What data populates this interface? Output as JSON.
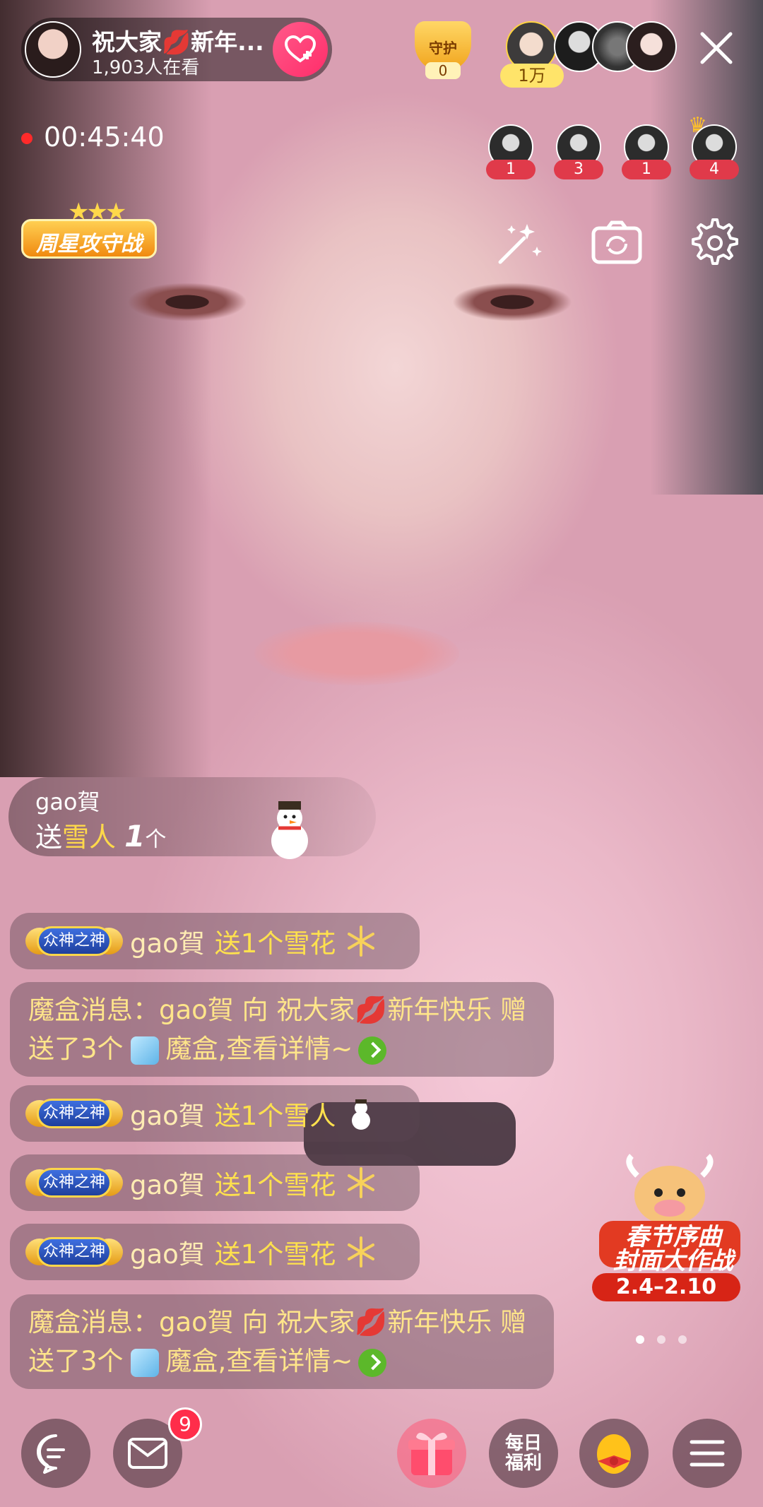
{
  "header": {
    "host_name": "祝大家💋新年...",
    "viewers": "1,903人在看",
    "guard_label": "守护",
    "guard_count": "0",
    "rank_tag": "1万",
    "timer": "00:45:40",
    "weekly_badge": "周星攻守战"
  },
  "fans": [
    {
      "count": "1"
    },
    {
      "count": "3"
    },
    {
      "count": "1"
    },
    {
      "count": "4"
    }
  ],
  "gift_notice": {
    "sender": "gao賀",
    "verb": "送",
    "gift_name": "雪人",
    "count": "1",
    "unit": "个"
  },
  "chat": {
    "medal_label": "众神之神",
    "messages": [
      {
        "user": "gao賀",
        "action": "送1个雪花",
        "icon": "snowflake-icon"
      },
      {
        "text": "魔盒消息：gao賀 向 祝大家💋新年快乐 赠送了3个",
        "tail": "魔盒,查看详情~"
      },
      {
        "user": "gao賀",
        "action": "送1个雪人",
        "icon": "snowman-icon"
      },
      {
        "user": "gao賀",
        "action": "送1个雪花",
        "icon": "snowflake-icon"
      },
      {
        "user": "gao賀",
        "action": "送1个雪花",
        "icon": "snowflake-icon"
      },
      {
        "text": "魔盒消息：gao賀 向 祝大家💋新年快乐 赠送了3个",
        "tail": "魔盒,查看详情~"
      }
    ]
  },
  "festival": {
    "title_line1": "春节序曲",
    "title_line2": "封面大作战",
    "dates": "2.4–2.10"
  },
  "bottom": {
    "mail_badge": "9",
    "daily_label_1": "每日",
    "daily_label_2": "福利"
  },
  "colors": {
    "follow": "#ff2d6a",
    "gift_name": "#ffd94a",
    "chat_action": "#ffe14d",
    "badge": "#ff2d4a"
  }
}
